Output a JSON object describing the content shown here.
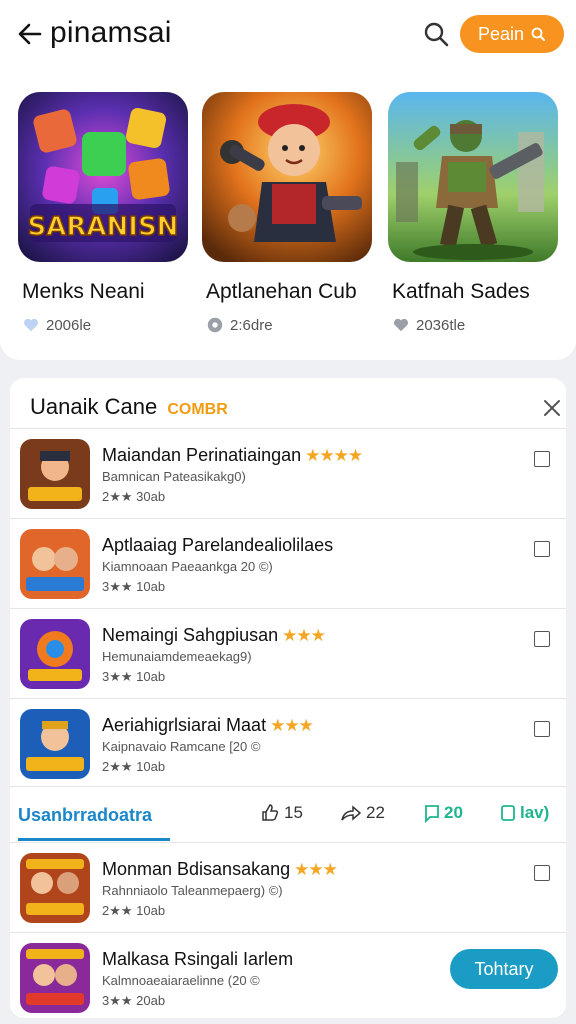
{
  "header": {
    "title": "pinamsai",
    "pill_label": "Peain"
  },
  "featured": [
    {
      "art_text": "SARANISN",
      "title": "Menks Neani",
      "meta": "2006le"
    },
    {
      "art_text": "",
      "title": "Aptlanehan Cub",
      "meta": "2:6dre"
    },
    {
      "art_text": "",
      "title": "Katfnah Sades",
      "meta": "2036tle"
    }
  ],
  "list": {
    "title": "Uanaik Cane",
    "tag": "COMBR",
    "rows": [
      {
        "title": "Maiandan Perinatiaingan",
        "stars": "★★★★",
        "sub": "Bamnican Pateasikakg0)",
        "meta": "2★★ 30ab"
      },
      {
        "title": "Aptlaaiag Parelandealiolilaes",
        "stars": "",
        "sub": "Kiamnoaan Paeaankga 20 ©)",
        "meta": "3★★ 10ab"
      },
      {
        "title": "Nemaingi Sahgpiusan",
        "stars": "★★★",
        "sub": "Hemunaiamdemeaekag9)",
        "meta": "3★★ 10ab"
      },
      {
        "title": "Aeriahigrlsiarai Maat",
        "stars": "★★★",
        "sub": "Kaipnavaio Ramcane [20 ©",
        "meta": "2★★ 10ab"
      }
    ],
    "action_bar": {
      "tab": "Usanbrradoatra",
      "like": "15",
      "share": "22",
      "comment": "20",
      "extra": "lav)"
    },
    "rows2": [
      {
        "title": "Monman Bdisansakang",
        "stars": "★★★",
        "sub": "Rahnniaolo Taleanmepaerg) ©)",
        "meta": "2★★ 10ab"
      },
      {
        "title": "Malkasa Rsingali Iarlem",
        "stars": "",
        "sub": "Kalmnoaeaiaraelinne (20 ©",
        "meta": "3★★ 20ab",
        "button": "Tohtary"
      }
    ]
  },
  "colors": {
    "accent_orange": "#f7931e",
    "accent_blue": "#1b87c9",
    "accent_green": "#1fb58f",
    "star": "#f5a623"
  }
}
